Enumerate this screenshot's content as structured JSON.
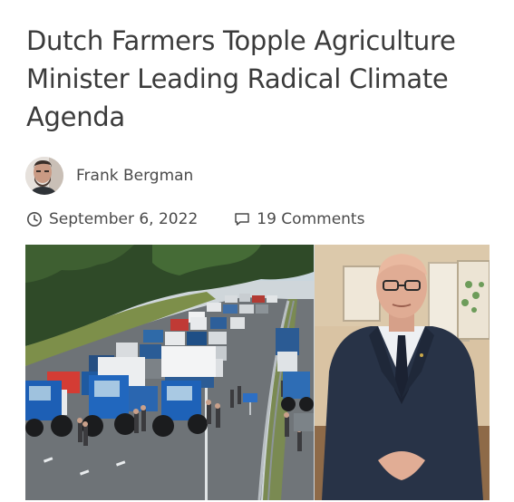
{
  "article": {
    "title": "Dutch Farmers Topple Agriculture Minister Leading Radical Climate Agenda",
    "author": {
      "name": "Frank Bergman",
      "avatar_icon": "person-avatar"
    },
    "meta": {
      "date": "September 6, 2022",
      "date_icon": "clock-icon",
      "comments": "19 Comments",
      "comments_icon": "speech-bubble-icon"
    },
    "featured_image": {
      "panels": [
        "tractor-protest-highway-photo",
        "minister-portrait-photo"
      ]
    }
  },
  "colors": {
    "text": "#3b3b3b",
    "meta_text": "#4a4a4a",
    "background": "#ffffff"
  }
}
